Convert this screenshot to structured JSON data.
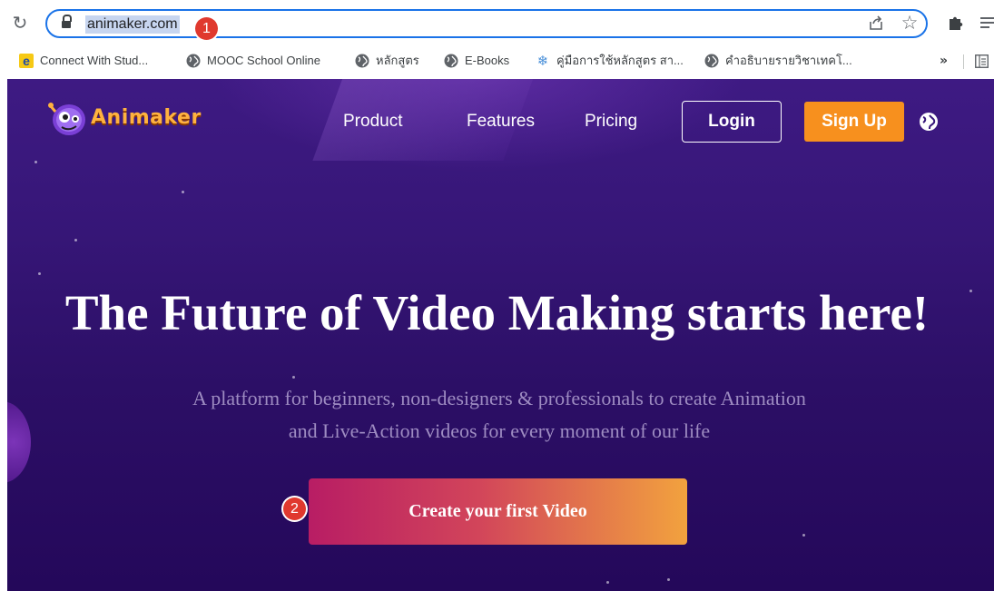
{
  "browser": {
    "url": "animaker.com",
    "markers": [
      "1",
      "2"
    ],
    "icons": {
      "reload": "reload-icon",
      "lock": "lock-icon",
      "share": "share-icon",
      "bookmark_star": "star-icon",
      "extensions": "puzzle-icon",
      "reading_list": "reading-list-icon"
    },
    "bookmarks": [
      {
        "label": "Connect With Stud...",
        "icon": "e-icon"
      },
      {
        "label": "MOOC School Online",
        "icon": "globe-icon"
      },
      {
        "label": "หลักสูตร",
        "icon": "globe-icon"
      },
      {
        "label": "E-Books",
        "icon": "globe-icon"
      },
      {
        "label": "คู่มือการใช้หลักสูตร สา...",
        "icon": "snowflake-icon"
      },
      {
        "label": "คำอธิบายรายวิชาเทคโ...",
        "icon": "globe-icon"
      }
    ],
    "overflow_label": "»"
  },
  "site": {
    "logo_text": "Animaker",
    "nav": {
      "product": "Product",
      "features": "Features",
      "pricing": "Pricing",
      "login": "Login",
      "signup": "Sign Up"
    },
    "headline": "The Future of Video Making starts here!",
    "subtitle_line1": "A platform for beginners, non-designers & professionals to create Animation",
    "subtitle_line2": "and Live-Action videos for every moment of our life",
    "cta": "Create your first Video"
  },
  "colors": {
    "accent": "#1a73e8",
    "marker": "#e0392e",
    "signup": "#f7901e",
    "logo": "#ffb23f",
    "background": "#2c0f66"
  }
}
